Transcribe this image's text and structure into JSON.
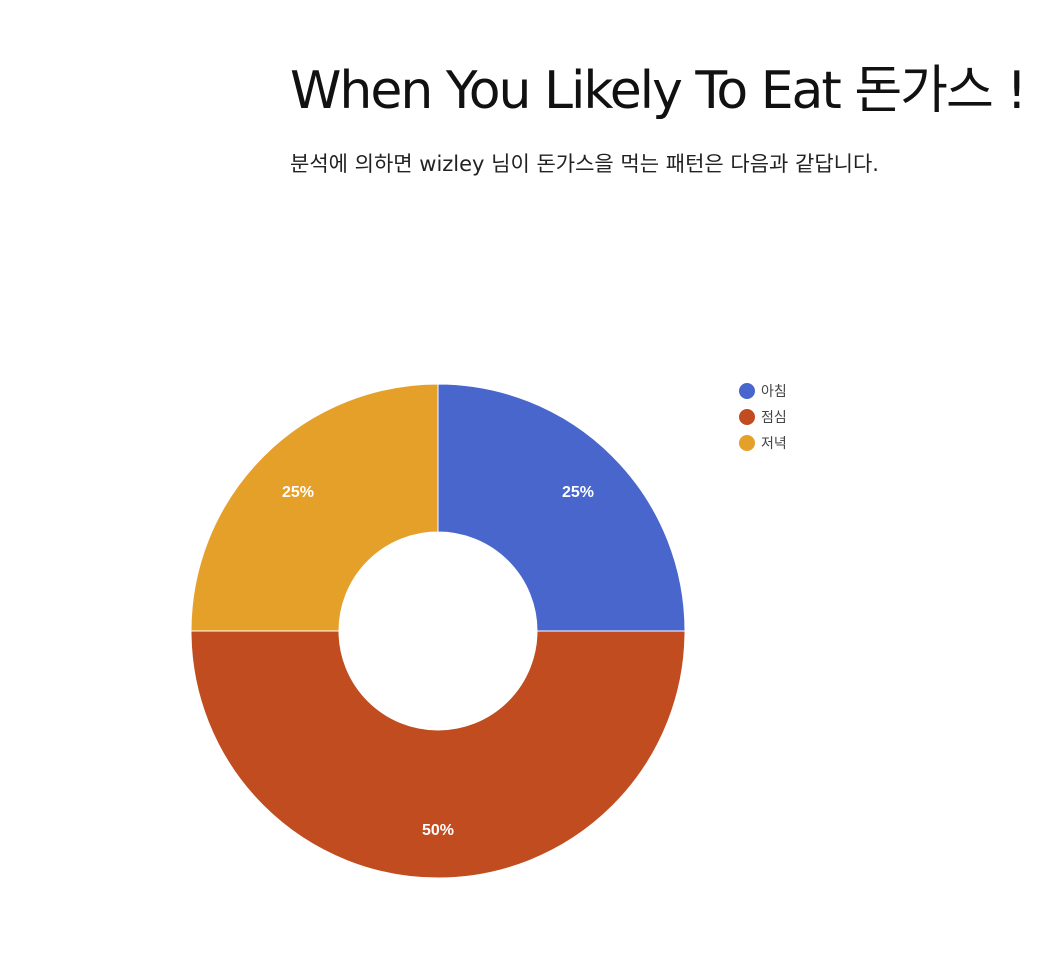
{
  "page": {
    "title": "When You Likely To Eat 돈가스 !",
    "subtitle": "분석에 의하면 wizley 님이 돈가스을 먹는 패턴은 다음과 같답니다."
  },
  "chart_data": {
    "type": "pie",
    "donut": true,
    "categories": [
      "아침",
      "점심",
      "저녁"
    ],
    "values": [
      25,
      50,
      25
    ],
    "data_labels": [
      "25%",
      "50%",
      "25%"
    ],
    "colors": [
      "#4866CB",
      "#C04C1F",
      "#E5A02A"
    ],
    "legend_position": "right"
  }
}
